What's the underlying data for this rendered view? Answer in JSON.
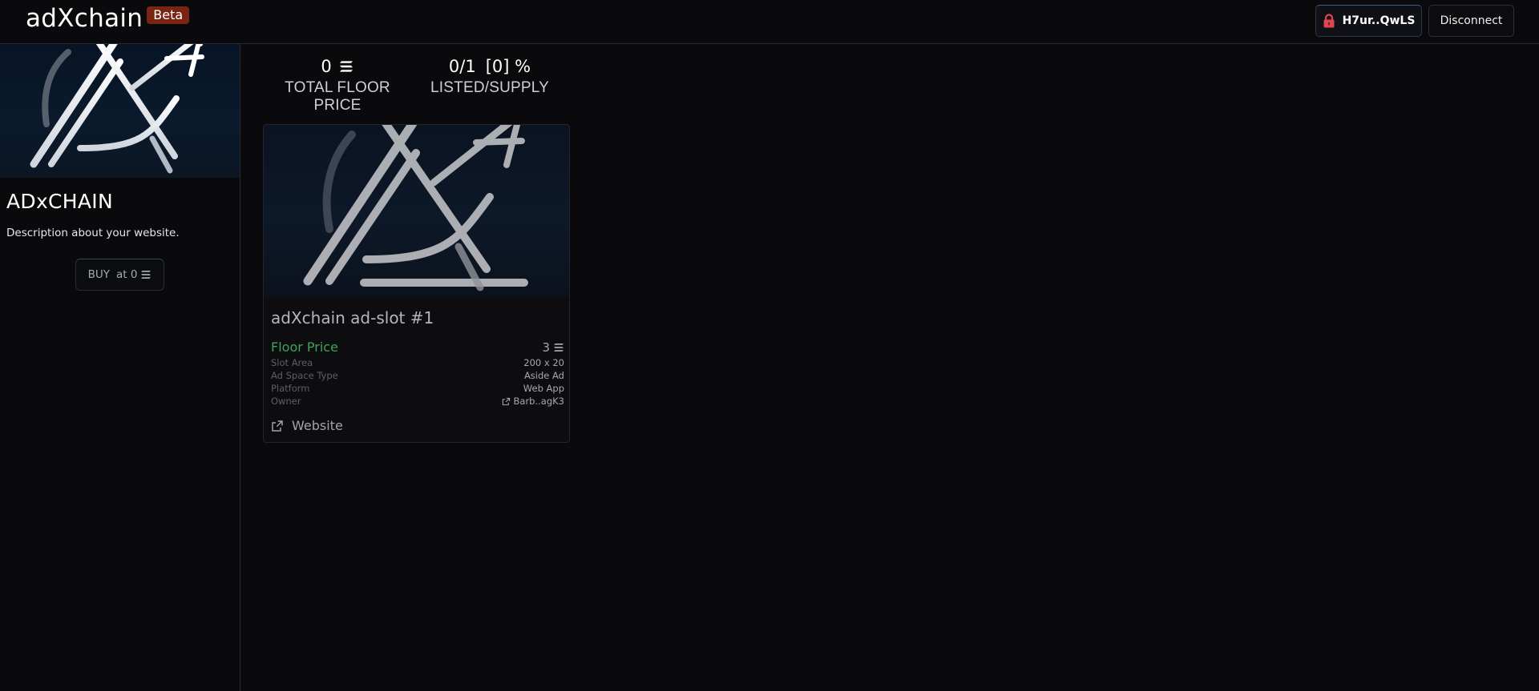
{
  "header": {
    "brand": "adXchain",
    "badge": "Beta",
    "wallet_address": "H7ur..QwLS",
    "disconnect_label": "Disconnect"
  },
  "sidebar": {
    "title": "ADxCHAIN",
    "description": "Description about your website.",
    "buy_label": "BUY",
    "buy_price": "at 0"
  },
  "stats": {
    "total_floor_value": "0",
    "total_floor_label": "TOTAL FLOOR PRICE",
    "listed_supply_value": "0/1",
    "listed_percent": "[0] %",
    "listed_supply_label": "LISTED/SUPPLY"
  },
  "card": {
    "title": "adXchain ad-slot #1",
    "floor_label": "Floor Price",
    "floor_value": "3",
    "meta": [
      {
        "key": "Slot Area",
        "value": "200 x 20"
      },
      {
        "key": "Ad Space Type",
        "value": "Aside Ad"
      },
      {
        "key": "Platform",
        "value": "Web App"
      },
      {
        "key": "Owner",
        "value": "Barb..agK3"
      }
    ],
    "website_label": "Website"
  },
  "icons": {
    "currency": "solana-icon",
    "lock": "lock-icon",
    "external": "external-link-icon"
  },
  "colors": {
    "background": "#0a0a0c",
    "badge": "#7a2414",
    "lock": "#e0454f",
    "floor_price": "#3ea35a"
  }
}
